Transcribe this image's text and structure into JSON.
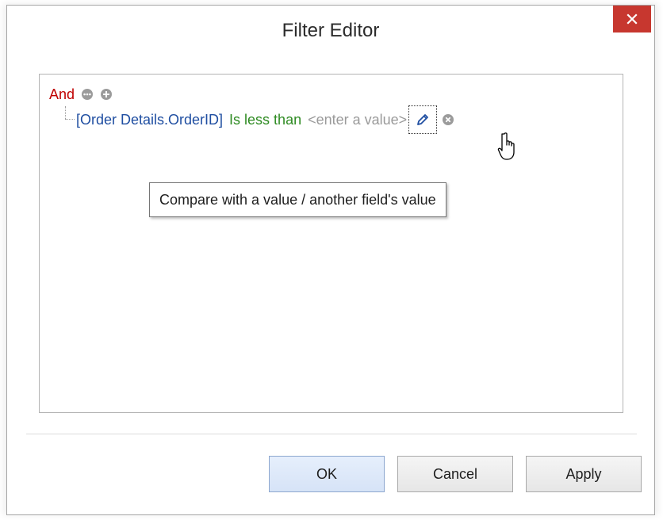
{
  "window": {
    "title": "Filter Editor",
    "close_icon": "close-icon"
  },
  "filter": {
    "group_operator": "And",
    "group_icons": [
      "options-icon",
      "add-icon"
    ],
    "condition": {
      "field": "[Order Details.OrderID]",
      "operator": "Is less than",
      "value_placeholder": "<enter a value>",
      "edit_icon": "pencil-icon",
      "remove_icon": "remove-icon"
    }
  },
  "tooltip": {
    "text": "Compare with a value / another field's value"
  },
  "buttons": {
    "ok": "OK",
    "cancel": "Cancel",
    "apply": "Apply"
  },
  "colors": {
    "close_button": "#c7372f",
    "group_operator": "#c00000",
    "field": "#1f4ea1",
    "operator": "#2e8b22",
    "value_placeholder": "#9a9a9a"
  }
}
